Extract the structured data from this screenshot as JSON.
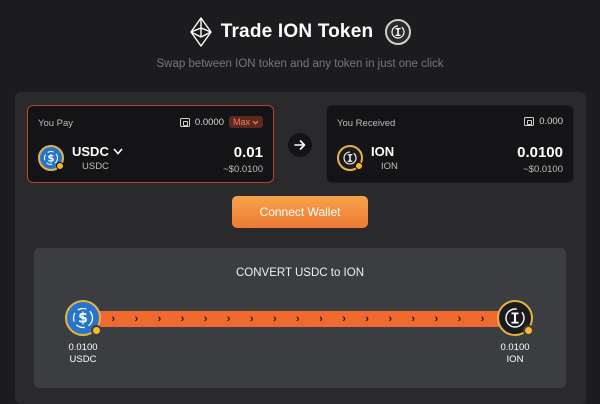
{
  "header": {
    "title": "Trade ION Token",
    "subtitle": "Swap between ION token and any token in just one click"
  },
  "pay_card": {
    "label": "You Pay",
    "balance": "0.0000",
    "max_label": "Max",
    "token_symbol": "USDC",
    "token_name": "USDC",
    "amount": "0.01",
    "usd_value": "~$0.0100"
  },
  "receive_card": {
    "label": "You Received",
    "balance": "0.000",
    "token_symbol": "ION",
    "token_name": "ION",
    "amount": "0.0100",
    "usd_value": "~$0.0100"
  },
  "connect_button": "Connect Wallet",
  "conversion": {
    "title": "CONVERT USDC to ION",
    "from_amount": "0.0100",
    "from_token": "USDC",
    "to_amount": "0.0100",
    "to_token": "ION"
  },
  "colors": {
    "accent": "#f06a30",
    "button_gradient_top": "#f5a34a",
    "button_gradient_bottom": "#ef7a35",
    "gold": "#e6b540",
    "usdc_blue": "#2775ca"
  },
  "icons": {
    "brand": "ethereum-logo-icon",
    "ion": "ion-coin-icon",
    "usdc": "usdc-coin-icon",
    "wallet": "wallet-icon",
    "swap": "arrow-right-icon",
    "dropdown": "chevron-down-icon"
  }
}
